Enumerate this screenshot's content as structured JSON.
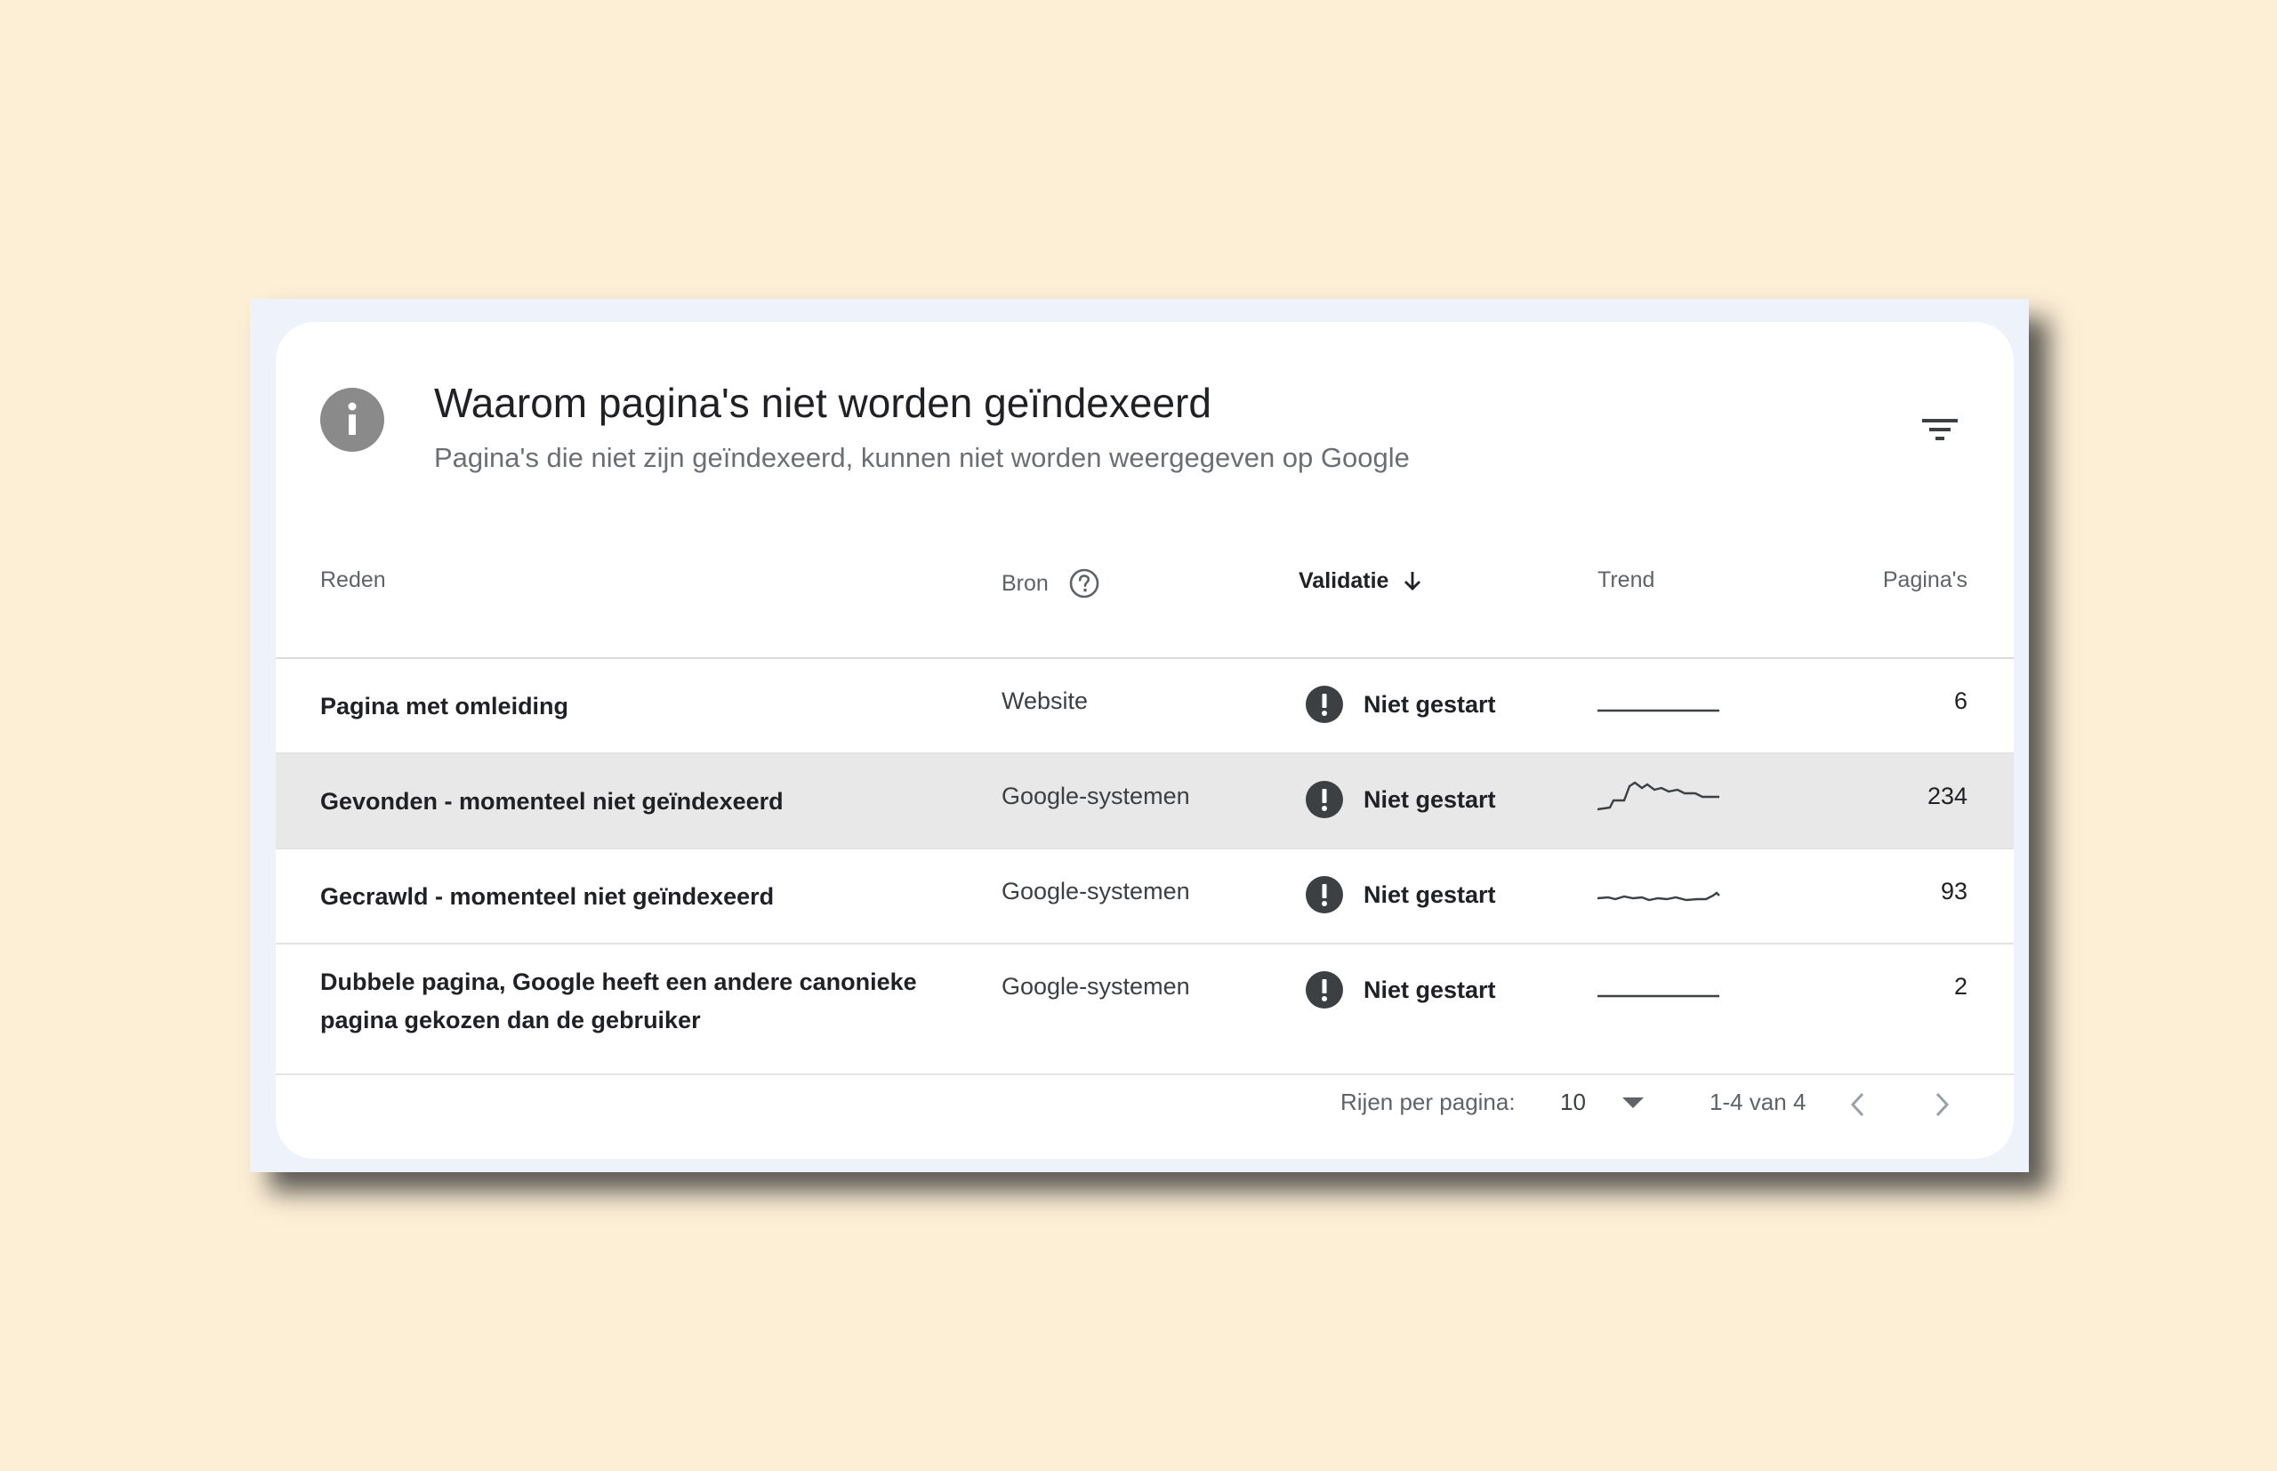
{
  "header": {
    "title": "Waarom pagina's niet worden geïndexeerd",
    "subtitle": "Pagina's die niet zijn geïndexeerd, kunnen niet worden weergegeven op Google"
  },
  "columns": {
    "reason": "Reden",
    "source": "Bron",
    "validation": "Validatie",
    "trend": "Trend",
    "pages": "Pagina's"
  },
  "rows": [
    {
      "reason": "Pagina met omleiding",
      "source": "Website",
      "validation": "Niet gestart",
      "pages": "6",
      "highlighted": false
    },
    {
      "reason": "Gevonden - momenteel niet geïndexeerd",
      "source": "Google-systemen",
      "validation": "Niet gestart",
      "pages": "234",
      "highlighted": true
    },
    {
      "reason": "Gecrawld - momenteel niet geïndexeerd",
      "source": "Google-systemen",
      "validation": "Niet gestart",
      "pages": "93",
      "highlighted": false
    },
    {
      "reason_line1": "Dubbele pagina, Google heeft een andere canonieke",
      "reason_line2": "pagina gekozen dan de gebruiker",
      "source": "Google-systemen",
      "validation": "Niet gestart",
      "pages": "2",
      "highlighted": false
    }
  ],
  "footer": {
    "rows_per_page_label": "Rijen per pagina:",
    "rows_per_page_value": "10",
    "range": "1-4 van 4"
  },
  "icons": {
    "header": "info-icon",
    "filter": "filter-icon",
    "help": "help-circle-icon",
    "sort": "arrow-down-icon",
    "status": "exclamation-circle-icon",
    "dropdown": "caret-down-icon",
    "prev": "chevron-left-icon",
    "next": "chevron-right-icon"
  },
  "colors": {
    "background": "#fdefd6",
    "card": "#ffffff",
    "highlight_row": "#e8e8e8",
    "status_icon": "#3c4043"
  }
}
